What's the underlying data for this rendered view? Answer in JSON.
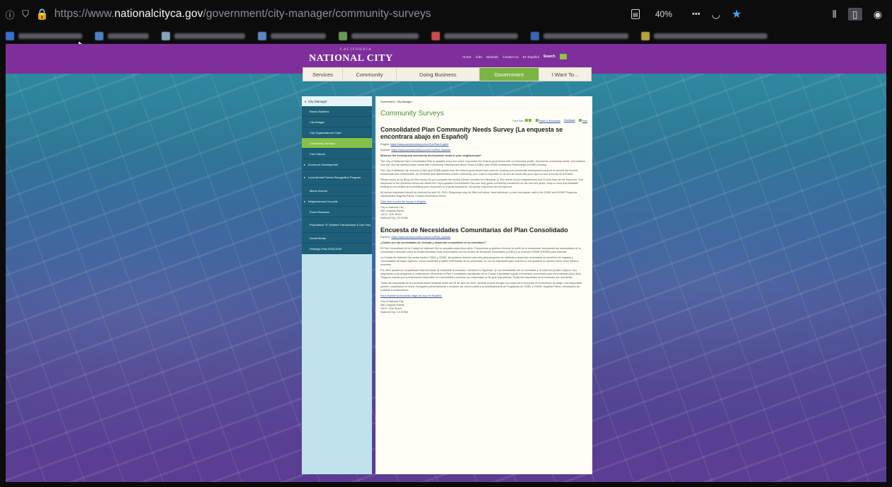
{
  "browser": {
    "url_prefix": "https://www.",
    "url_domain": "nationalcityca.gov",
    "url_path": "/government/city-manager/community-surveys",
    "zoom": "40%",
    "more_label": "•••"
  },
  "site": {
    "logo_state": "CALIFORNIA",
    "logo_name": "NATIONAL CITY",
    "top_links": [
      "Home",
      "Jobs",
      "Maintain",
      "Contact Us",
      "En Español"
    ],
    "search_label": "Search",
    "main_nav": [
      {
        "label": "Services"
      },
      {
        "label": "Community"
      },
      {
        "label": "Doing Business"
      },
      {
        "label": "Government"
      },
      {
        "label": "I Want To..."
      }
    ]
  },
  "sidebar": {
    "header": "City Manager",
    "items": [
      {
        "label": "Brad's Bulletins"
      },
      {
        "label": "City Budget"
      },
      {
        "label": "City Organizational Chart"
      },
      {
        "label": "Community Surveys"
      },
      {
        "label": "Core Values"
      },
      {
        "label": "Economic Development"
      },
      {
        "label": "Local Armed Forces Recognition Program"
      },
      {
        "label": "March Around"
      },
      {
        "label": "Neighborhood Councils"
      },
      {
        "label": "Press Releases"
      },
      {
        "label": "Proposition \"D\" (District Transactions & Use Tax)"
      },
      {
        "label": "Social Media"
      },
      {
        "label": "Strategic Plan 2020-2025"
      }
    ]
  },
  "content": {
    "breadcrumb": "Government › City Manager ›",
    "page_title": "Community Surveys",
    "tools": {
      "font_size": "Font Size:",
      "share": "Share & Bookmark",
      "feedback": "Feedback",
      "print": "Print"
    },
    "heading_en": "Consolidated Plan Community Needs Survey (La enquesta se encontrara abajo en Español)",
    "english_label": "English:",
    "english_link": "https://www.surveymonkey.com/r/ConPlan-English",
    "spanish_label": "Spanish:",
    "spanish_link": "https://www.surveymonkey.com/r/ConPlan-Spanish",
    "question_en": "What are the housing and community development needs in your neighborhood?",
    "p1_en": "The City of National City's Consolidated Plan is updated every five years. It provides the federal government with a community profile, documents community needs, and outlines how the City will address those needs with Community Development Block Grant (CDBG) and HOME Investment Partnerships (HOME) funding.",
    "p2_en": "The City of National City receives CDBG and HOME grants from the federal government each year for housing and community development projects to benefit low-income households and communities. As residents and stakeholders of this community, your voice is important to us and we would like your input on how it should be invested.",
    "p3_en": "Please assist us by filling out this survey. As you complete the survey, please consider the following: 1) The needs of your neighborhood and 2) how they can be improved. Your responses to the questions below will inform the City's updated Consolidated Plan and help guide community investment for the next five years. Keep in mind that available funding is very limited and prioritizing your responses is of great importance. All survey responses are anonymous.",
    "p4_en": "All survey responses should be received by April 30, 2020. Responses may be filled out online, hand delivered, or sent via regular mail to the CDBG and HOME Programs Administrator Angelita Palma. Contact information below.",
    "print_link_en": "Click here to print the survey in English.",
    "address": [
      "City of National City",
      "Attn: Angelita Palma",
      "140 E. 12th Street",
      "National City, CA 91950"
    ],
    "heading_es": "Encuesta de Necesidades Comunitarias del Plan Consolidado",
    "spanish_label_es": "Español:",
    "spanish_link_es": "https://www.surveymonkey.com/r/ConPlan-Spanish",
    "question_es": "¿Cuáles son las necesidades de vivienda y desarrollo comunitario en su vecindario?",
    "p1_es": "El Plan Consolidado de la Ciudad de National City se actualiza cada cinco años. Proporciona al gobierno federal un perfil de la comunidad, documenta las necesidades de la comunidad y describe cómo la Ciudad abordará esas necesidades con los fondos de desarrollo comunitario (CDBG) y la inversión HOME (HOME) para vivienda.",
    "p2_es": "La Ciudad de National City recibe fondos CDBG y HOME del gobierno federal cada año para proyectos de vivienda y desarrollo comunitario en beneficio de hogares y comunidades de bajos ingresos. Como residentes y partes interesadas de la comunidad, su voz es importante para nosotros y nos gustaría su opinión sobre cómo debería invertirse.",
    "p3_es": "Por favor ayúdenos completando esta encuesta. Al completar la encuesta, considere lo siguiente: 1) Las necesidades de su vecindario y 2) cómo se pueden mejorar. Sus respuestas a las preguntas a continuación informarán el Plan Consolidado actualizado de la Ciudad y ayudarán a guiar la inversión comunitaria para los próximos cinco años. Tenga en cuenta que la financiación disponible es muy limitada y priorizar sus respuestas es de gran importancia. Todas las respuestas de la encuesta son anónimas.",
    "p4_es": "Todas las respuestas de la encuesta deben recibirse antes del 30 de abril de 2020. También puede recoger una copia de la encuesta en la dirección de abajo. Las respuestas pueden completarse en línea, entregarse personalmente o enviarse por correo postal a la Administradora de Programas de CDBG y HOME, Angelita Palma. Información de contacto a continuación.",
    "print_link_es": "Para imprimir la encuesta, haga clic aquí en Español.",
    "address_es": [
      "City of National City",
      "Attn: Angelita Palma",
      "140 E. 12th Street",
      "National City, CA 91950"
    ]
  },
  "colors": {
    "purple_band": "#7f2f9b",
    "nav_active": "#7bb443",
    "sidebar_dark": "#1d5f78",
    "title_green": "#4d8b2d"
  }
}
